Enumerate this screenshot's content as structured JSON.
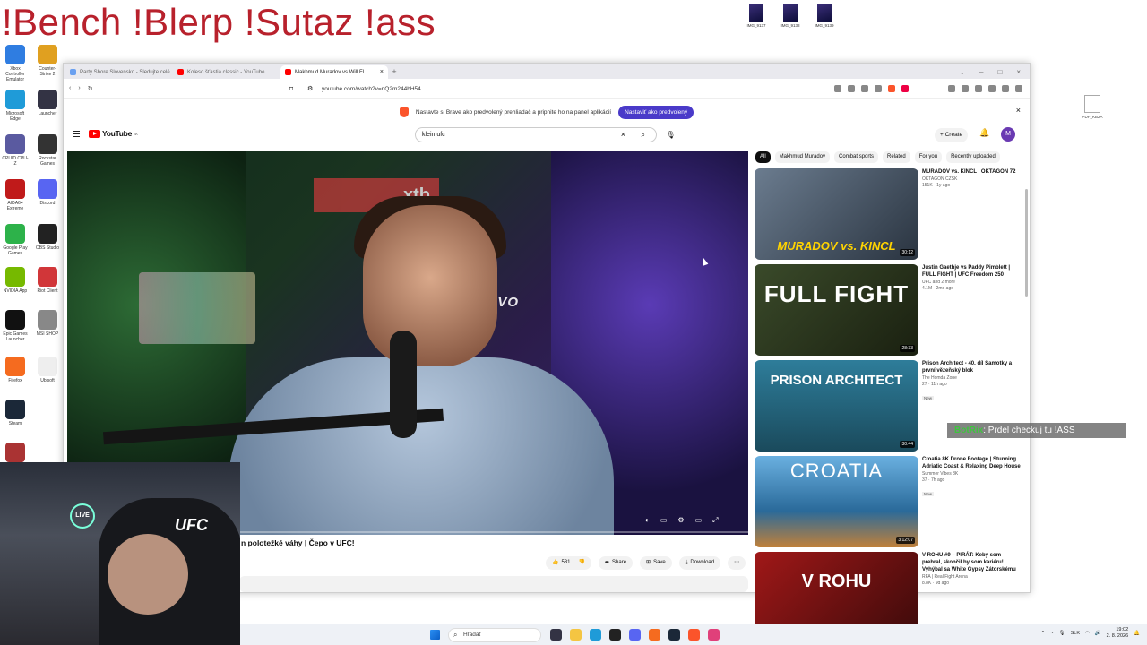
{
  "overlay": {
    "title": "!Bench !Blerp !Sutaz !ass"
  },
  "desktop": {
    "left_icons": [
      {
        "label": "Xbox Controller Emulator",
        "color": "#2f7de1"
      },
      {
        "label": "Counter-Strike 2",
        "color": "#e0a020"
      },
      {
        "label": "Microsoft Edge",
        "color": "#1f9bd8"
      },
      {
        "label": "Launcher",
        "color": "#334"
      },
      {
        "label": "CPUID CPU-Z",
        "color": "#5a5aa0"
      },
      {
        "label": "Rockstar Games",
        "color": "#333"
      },
      {
        "label": "AIDA64 Extreme",
        "color": "#c01a1a"
      },
      {
        "label": "Discord",
        "color": "#5865f2"
      },
      {
        "label": "Google Play Games",
        "color": "#2db24a"
      },
      {
        "label": "OBS Studio",
        "color": "#222"
      },
      {
        "label": "NVIDIA App",
        "color": "#76b900"
      },
      {
        "label": "Riot Client",
        "color": "#d13639"
      },
      {
        "label": "Epic Games Launcher",
        "color": "#111"
      },
      {
        "label": "MSI SHOP",
        "color": "#888"
      },
      {
        "label": "Firefox",
        "color": "#f56b1f"
      },
      {
        "label": "Ubisoft",
        "color": "#eee"
      },
      {
        "label": "Steam",
        "color": "#1b2838"
      },
      {
        "label": "",
        "color": "#a33"
      }
    ],
    "top_right_icons": [
      "IMG_9137",
      "IMG_9138",
      "IMG_9139"
    ],
    "pdf_icon_label": "PDF_KB2A"
  },
  "browser": {
    "tabs": [
      {
        "title": "Party Shore Slovensko - Sledujte celé",
        "active": false,
        "favicon_color": "#6aa0f0"
      },
      {
        "title": "Koleso šťastia classic - YouTube",
        "active": false,
        "favicon_color": "#ff0000"
      },
      {
        "title": "Makhmud Muradov vs Will Fl",
        "active": true,
        "favicon_color": "#ff0000"
      }
    ],
    "new_tab": "+",
    "url": "youtube.com/watch?v=nQ2m244bH54",
    "notice_text": "Nastavte si Brave ako predvolený prehliadač a pripnite ho na panel aplikácií",
    "notice_button": "Nastaviť ako predvolený"
  },
  "youtube": {
    "logo_text": "YouTube",
    "logo_sup": "SK",
    "search_value": "klein ufc",
    "create_label": "Create",
    "avatar_letter": "M",
    "video_title": "n polotežké váhy | Čepo v UFC!",
    "video_watermark": "xtb",
    "like_count": "531",
    "share_label": "Share",
    "save_label": "Save",
    "download_label": "Download",
    "chips": [
      "All",
      "Makhmud Muradov",
      "Combat sports",
      "Related",
      "For you",
      "Recently uploaded"
    ],
    "recommendations": [
      {
        "title": "MURADOV vs. KINCL | OKTAGON 72",
        "channel": "OKTAGON CZSK",
        "meta": "151K · 1y ago",
        "duration": "30:12",
        "thumb_text": "MURADOV vs. KINCL",
        "new": ""
      },
      {
        "title": "Justin Gaethje vs Paddy Pimblett | FULL FIGHT | UFC Freedom 250",
        "channel": "UFC and 2 more",
        "meta": "4.1M · 2mo ago",
        "duration": "28:33",
        "thumb_text": "FULL FIGHT",
        "new": ""
      },
      {
        "title": "Prison Architect - 40. díl Samotky a první vězeňský blok",
        "channel": "The Homda Zone",
        "meta": "27 · 11h ago",
        "duration": "30:44",
        "thumb_text": "PRISON ARCHITECT",
        "new": "New"
      },
      {
        "title": "Croatia 8K Drone Footage | Stunning Adriatic Coast & Relaxing Deep House",
        "channel": "Summer Vibes 8K",
        "meta": "37 · 7h ago",
        "duration": "3:12:07",
        "thumb_text": "CROATIA",
        "new": "New"
      },
      {
        "title": "V ROHU #9 – PIRÁT: Keby som prehral, skončil by som kariéru! Vyhýbal sa White Gypsy Zátorskému",
        "channel": "RFA | Real Fight Arena",
        "meta": "8.8K · 9d ago",
        "duration": "",
        "thumb_text": "V ROHU",
        "new": ""
      }
    ]
  },
  "stream": {
    "chat_user": "BotRix",
    "chat_message": ": Prdel checkuj tu !ASS",
    "live_badge": "LIVE",
    "shirt_text": "UFC"
  },
  "taskbar": {
    "search_placeholder": "Hľadať",
    "lang": "SLK",
    "time": "19:02",
    "date": "2. 8. 2026"
  }
}
